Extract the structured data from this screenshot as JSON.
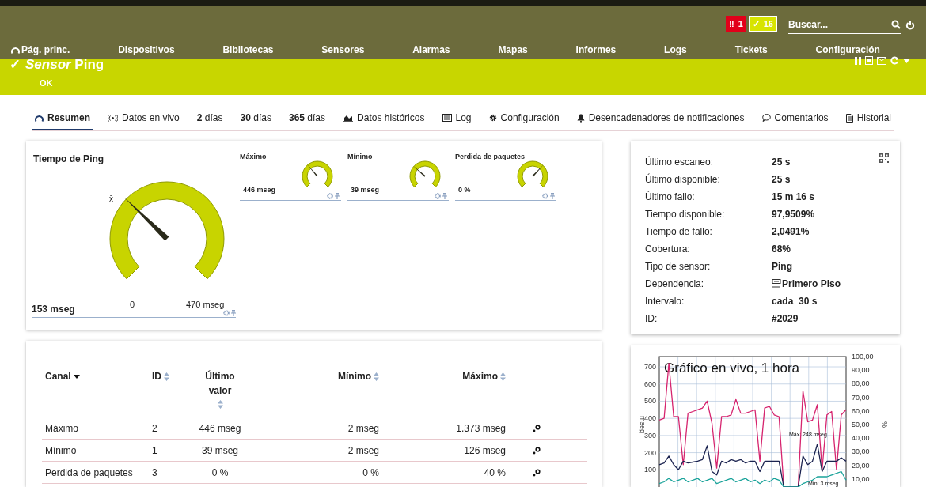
{
  "top_bar": {
    "alerts": [
      {
        "kind": "error",
        "icon": "‼",
        "count": "1"
      },
      {
        "kind": "ok",
        "icon": "✓",
        "count": "16"
      }
    ],
    "search": {
      "placeholder": "Buscar..."
    }
  },
  "nav": [
    "Pág. princ.",
    "Dispositivos",
    "Bibliotecas",
    "Sensores",
    "Alarmas",
    "Mapas",
    "Informes",
    "Logs",
    "Tickets",
    "Configuración"
  ],
  "sensor": {
    "check": "✓",
    "title": "*Sensor* Ping",
    "status": "OK"
  },
  "tabs": [
    {
      "label": "Resumen",
      "kind": "gauge",
      "selected": true
    },
    {
      "label": "Datos en vivo",
      "kind": "live",
      "selected": false
    },
    {
      "label": "**2** días",
      "kind": "plain",
      "selected": false
    },
    {
      "label": "**30** días",
      "kind": "plain",
      "selected": false
    },
    {
      "label": "**365** días",
      "kind": "plain",
      "selected": false
    },
    {
      "label": "Datos históricos",
      "kind": "chart",
      "selected": false
    },
    {
      "label": "Log",
      "kind": "log",
      "selected": false
    },
    {
      "label": "Configuración",
      "kind": "settings",
      "selected": false
    },
    {
      "label": "Desencadenadores de notificaciones",
      "kind": "bell",
      "selected": false
    },
    {
      "label": "Comentarios",
      "kind": "comment",
      "selected": false
    },
    {
      "label": "Historial",
      "kind": "history",
      "selected": false
    }
  ],
  "main_gauge": {
    "title": "Tiempo de Ping",
    "value": "153 mseg",
    "min": "0",
    "max": "470 mseg",
    "mean_marker": "x̄",
    "level": 0.33
  },
  "small_gauges": [
    {
      "title": "Máximo",
      "value": "446 mseg",
      "level": 0.35
    },
    {
      "title": "Mínimo",
      "value": "39 mseg",
      "level": 0.32
    },
    {
      "title": "Perdida de paquetes",
      "value": "0 %",
      "level": 0.66
    }
  ],
  "details": [
    {
      "label": "Último escaneo:",
      "value": "25 s",
      "kind": "text"
    },
    {
      "label": "Último disponible:",
      "value": "25 s",
      "kind": "text"
    },
    {
      "label": "Último fallo:",
      "value": "15 m 16 s",
      "kind": "text"
    },
    {
      "label": "Tiempo disponible:",
      "value": "97,9509%",
      "kind": "text"
    },
    {
      "label": "Tiempo de fallo:",
      "value": "2,0491%",
      "kind": "text"
    },
    {
      "label": "Cobertura:",
      "value": "68%",
      "kind": "text"
    },
    {
      "label": "Tipo de sensor:",
      "value": "Ping",
      "kind": "text"
    },
    {
      "label": "Dependencia:",
      "value": "Primero Piso",
      "kind": "link"
    },
    {
      "label": "Intervalo:",
      "value": "cada  30 s",
      "kind": "text"
    },
    {
      "label": "ID:",
      "value": "#2029",
      "kind": "text"
    }
  ],
  "table": {
    "columns": [
      {
        "label": "Canal",
        "sorted": true
      },
      {
        "label": "ID",
        "sorted": false
      },
      {
        "label": "Último valor",
        "sorted": false
      },
      {
        "label": "Mínimo",
        "sorted": false
      },
      {
        "label": "Máximo",
        "sorted": false
      }
    ],
    "rows": [
      [
        "Máximo",
        "2",
        "446 mseg",
        "2 mseg",
        "1.373 mseg"
      ],
      [
        "Mínimo",
        "1",
        "39 mseg",
        "2 mseg",
        "126 mseg"
      ],
      [
        "Perdida de paquetes",
        "3",
        "0 %",
        "0 %",
        "40 %"
      ]
    ]
  },
  "live_chart": {
    "chart_data": {
      "type": "line",
      "title": "Gráfico en vivo, 1 hora",
      "ylabel": "mseg",
      "grid": true,
      "ylim": [
        0,
        760
      ],
      "yticks": [
        100,
        200,
        300,
        400,
        500,
        600,
        700
      ],
      "series": [
        {
          "color": "#d6246e",
          "values": [
            390,
            400,
            720,
            410,
            410,
            130,
            430,
            440,
            450,
            460,
            500,
            370,
            110,
            410,
            410,
            420,
            510,
            430,
            430,
            440,
            450,
            150,
            460,
            470,
            420,
            410,
            0,
            0,
            0,
            0,
            560,
            380,
            390,
            480,
            100,
            420,
            440,
            100,
            420,
            450
          ]
        },
        {
          "color": "#1b2350",
          "values": [
            130,
            140,
            180,
            130,
            100,
            150,
            140,
            145,
            150,
            160,
            240,
            90,
            70,
            150,
            140,
            160,
            150,
            160,
            140,
            150,
            150,
            90,
            150,
            150,
            150,
            150,
            0,
            0,
            0,
            0,
            180,
            130,
            150,
            250,
            90,
            150,
            150,
            150,
            170,
            150
          ]
        },
        {
          "color": "#1aa39a",
          "values": [
            20,
            30,
            50,
            30,
            40,
            50,
            30,
            40,
            50,
            30,
            40,
            50,
            20,
            30,
            40,
            50,
            30,
            40,
            50,
            30,
            40,
            20,
            40,
            30,
            50,
            40,
            0,
            0,
            0,
            0,
            20,
            30,
            40,
            60,
            60,
            60,
            70,
            80,
            90,
            40
          ]
        }
      ],
      "annotations": [
        "Máx: 248 mseg",
        "Mín: 3 mseg"
      ]
    },
    "right_axis": {
      "label": "%",
      "ticks": [
        "100,00",
        "90,00",
        "80,00",
        "70,00",
        "60,00",
        "50,00",
        "40,00",
        "30,00",
        "20,00",
        "10,00"
      ]
    }
  }
}
